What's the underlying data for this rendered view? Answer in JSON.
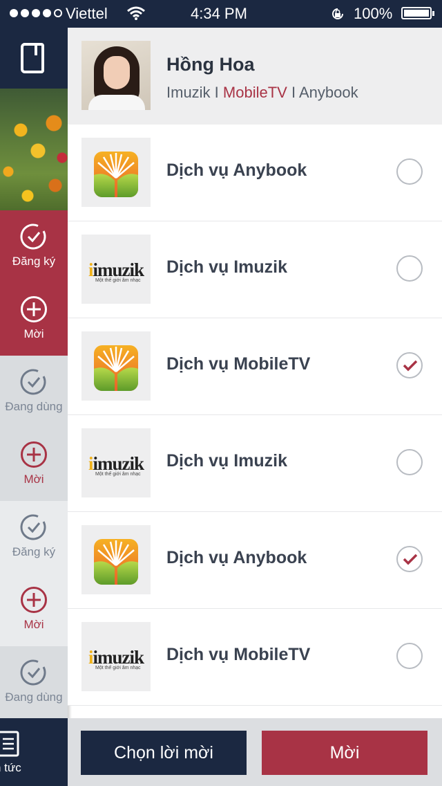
{
  "status_bar": {
    "carrier": "Viettel",
    "time": "4:34 PM",
    "battery": "100%"
  },
  "rail": {
    "items": [
      {
        "label": "Đăng ký",
        "icon": "check-circle-icon"
      },
      {
        "label": "Mời",
        "icon": "plus-circle-icon"
      },
      {
        "label": "Đang dùng",
        "icon": "check-circle-icon"
      },
      {
        "label": "Mời",
        "icon": "plus-circle-icon"
      },
      {
        "label": "Đăng ký",
        "icon": "check-circle-icon"
      },
      {
        "label": "Mời",
        "icon": "plus-circle-icon"
      },
      {
        "label": "Đang dùng",
        "icon": "check-circle-icon"
      }
    ],
    "bottom_label": "n tức"
  },
  "profile": {
    "name": "Hồng Hoa",
    "service_1": "Imuzik",
    "separator": " I ",
    "service_2": "MobileTV",
    "service_3": "Anybook"
  },
  "services": [
    {
      "title": "Dịch vụ Anybook",
      "logo": "anybook-logo",
      "selected": false
    },
    {
      "title": "Dịch vụ Imuzik",
      "logo": "imuzik-logo",
      "selected": false
    },
    {
      "title": "Dịch vụ MobileTV",
      "logo": "anybook-logo",
      "selected": true
    },
    {
      "title": "Dịch vụ Imuzik",
      "logo": "imuzik-logo",
      "selected": false
    },
    {
      "title": "Dịch vụ Anybook",
      "logo": "anybook-logo",
      "selected": true
    },
    {
      "title": "Dịch vụ MobileTV",
      "logo": "imuzik-logo",
      "selected": false
    }
  ],
  "imuzik_logo": {
    "wordmark": "imuzik",
    "tagline": "Một thế giới âm nhạc"
  },
  "actions": {
    "choose_label": "Chọn lời mời",
    "invite_label": "Mời"
  },
  "colors": {
    "navy": "#1b2841",
    "accent_red": "#a83345",
    "check_red": "#a83345"
  }
}
